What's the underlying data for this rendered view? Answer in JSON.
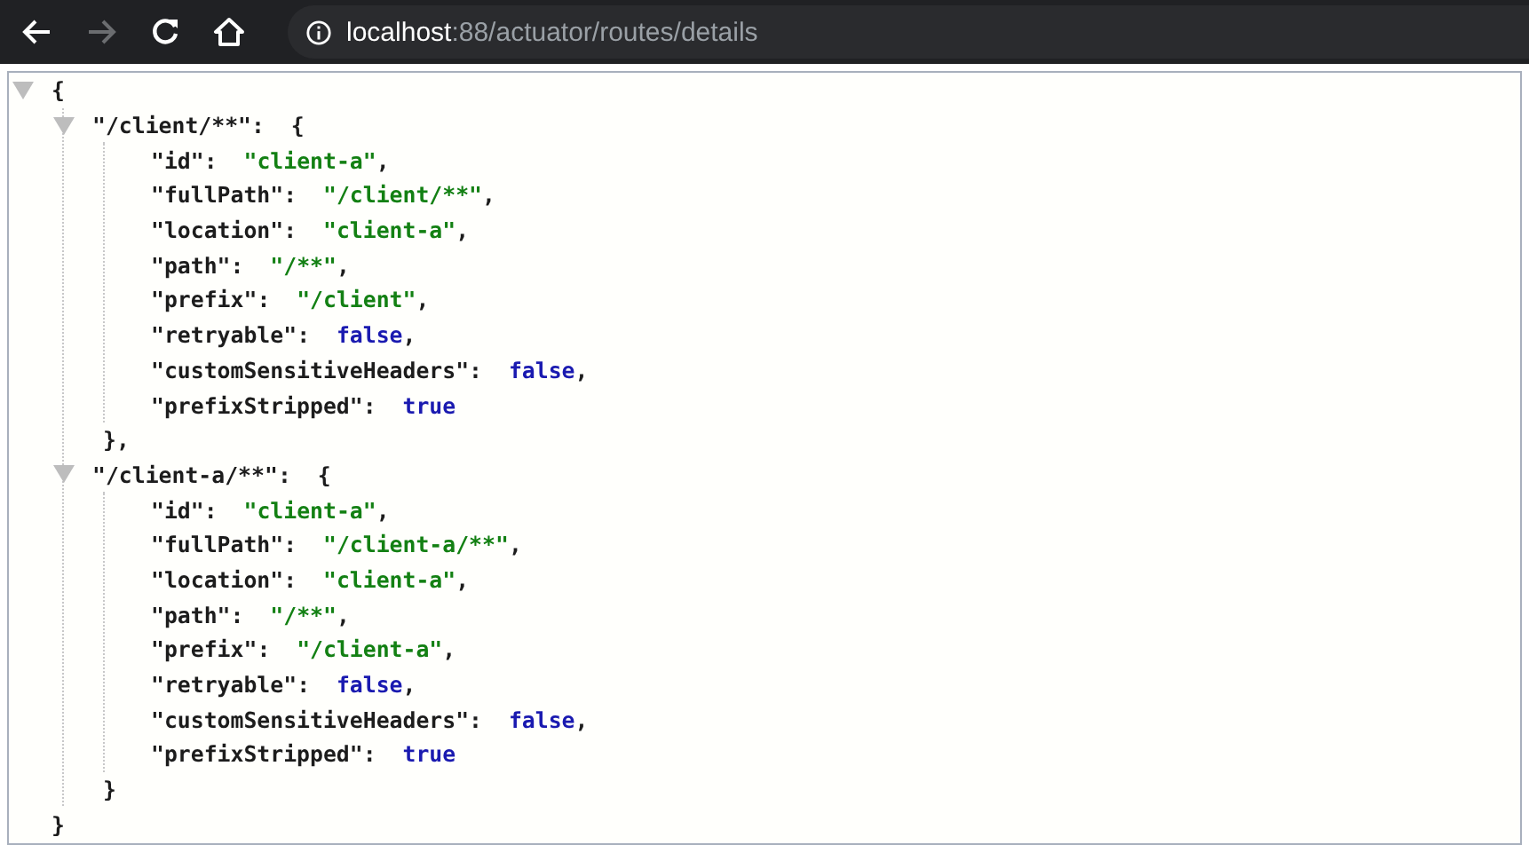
{
  "toolbar": {
    "url_host": "localhost",
    "url_rest": ":88/actuator/routes/details",
    "forward_disabled": true
  },
  "document": {
    "open": "{",
    "close": "}",
    "expanded": true,
    "groups": [
      {
        "key": "\"/client/**\"",
        "sep": ":",
        "open": "{",
        "close": "},",
        "expanded": true,
        "properties": [
          {
            "key": "\"id\"",
            "sep": ":",
            "value": "\"client-a\"",
            "kind": "string",
            "end": ","
          },
          {
            "key": "\"fullPath\"",
            "sep": ":",
            "value": "\"/client/**\"",
            "kind": "string",
            "end": ","
          },
          {
            "key": "\"location\"",
            "sep": ":",
            "value": "\"client-a\"",
            "kind": "string",
            "end": ","
          },
          {
            "key": "\"path\"",
            "sep": ":",
            "value": "\"/**\"",
            "kind": "string",
            "end": ","
          },
          {
            "key": "\"prefix\"",
            "sep": ":",
            "value": "\"/client\"",
            "kind": "string",
            "end": ","
          },
          {
            "key": "\"retryable\"",
            "sep": ":",
            "value": "false",
            "kind": "boolean",
            "end": ","
          },
          {
            "key": "\"customSensitiveHeaders\"",
            "sep": ":",
            "value": "false",
            "kind": "boolean",
            "end": ","
          },
          {
            "key": "\"prefixStripped\"",
            "sep": ":",
            "value": "true",
            "kind": "boolean"
          }
        ]
      },
      {
        "key": "\"/client-a/**\"",
        "sep": ":",
        "open": "{",
        "close": "}",
        "expanded": true,
        "properties": [
          {
            "key": "\"id\"",
            "sep": ":",
            "value": "\"client-a\"",
            "kind": "string",
            "end": ","
          },
          {
            "key": "\"fullPath\"",
            "sep": ":",
            "value": "\"/client-a/**\"",
            "kind": "string",
            "end": ","
          },
          {
            "key": "\"location\"",
            "sep": ":",
            "value": "\"client-a\"",
            "kind": "string",
            "end": ","
          },
          {
            "key": "\"path\"",
            "sep": ":",
            "value": "\"/**\"",
            "kind": "string",
            "end": ","
          },
          {
            "key": "\"prefix\"",
            "sep": ":",
            "value": "\"/client-a\"",
            "kind": "string",
            "end": ","
          },
          {
            "key": "\"retryable\"",
            "sep": ":",
            "value": "false",
            "kind": "boolean",
            "end": ","
          },
          {
            "key": "\"customSensitiveHeaders\"",
            "sep": ":",
            "value": "false",
            "kind": "boolean",
            "end": ","
          },
          {
            "key": "\"prefixStripped\"",
            "sep": ":",
            "value": "true",
            "kind": "boolean"
          }
        ]
      }
    ]
  }
}
